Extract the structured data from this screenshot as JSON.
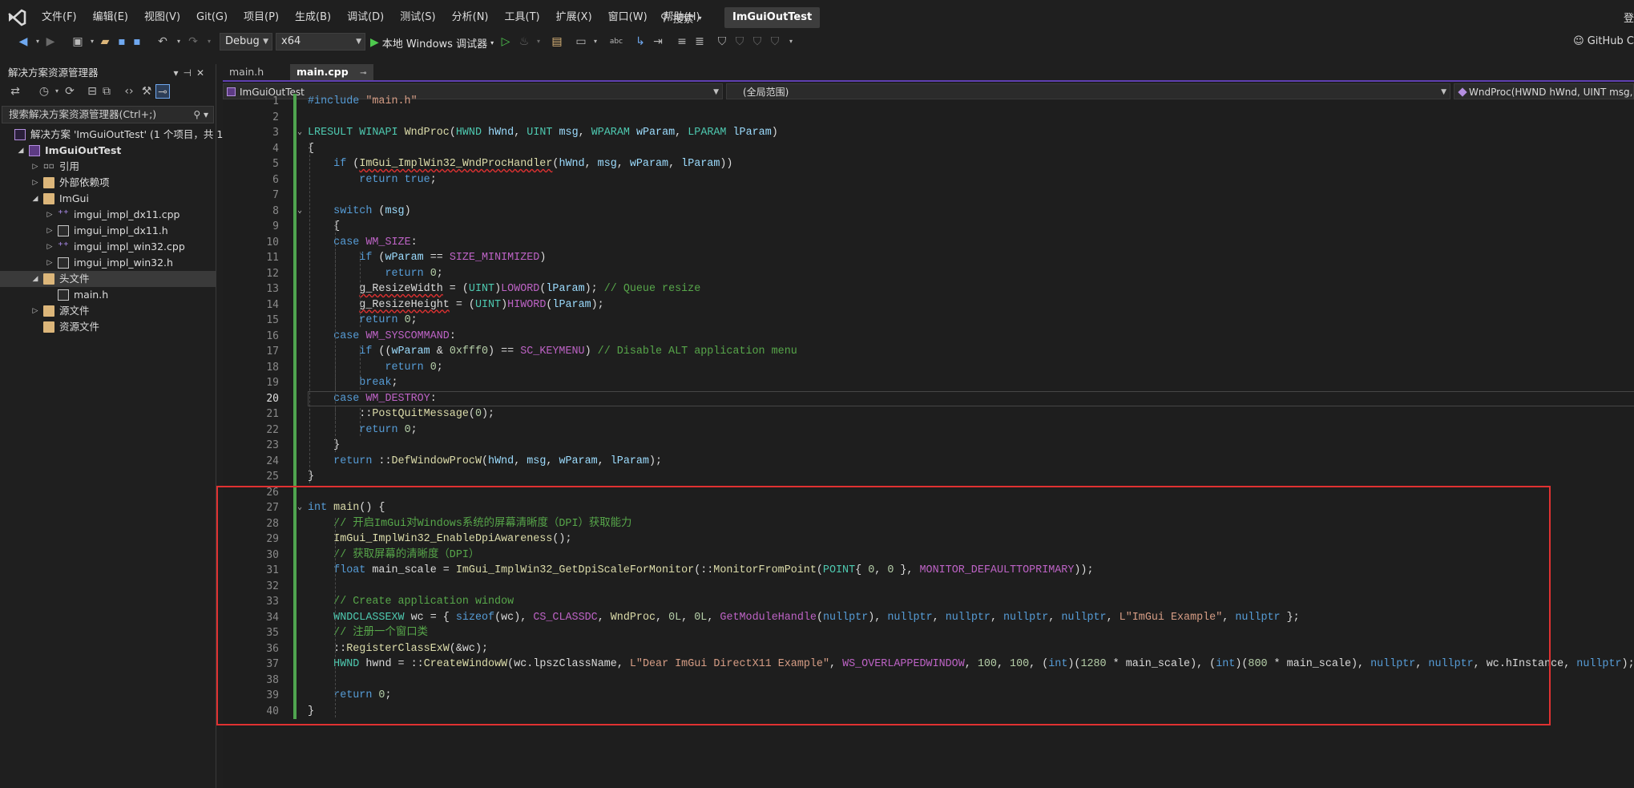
{
  "menubar": {
    "items": [
      "文件(F)",
      "编辑(E)",
      "视图(V)",
      "Git(G)",
      "项目(P)",
      "生成(B)",
      "调试(D)",
      "测试(S)",
      "分析(N)",
      "工具(T)",
      "扩展(X)",
      "窗口(W)",
      "帮助(H)"
    ],
    "search_label": "搜索",
    "solution_title": "ImGuiOutTest",
    "signin_label": "登"
  },
  "toolbar": {
    "configuration": "Debug",
    "platform": "x64",
    "run_label": "本地 Windows 调试器",
    "copilot_label": "GitHub C"
  },
  "solution_explorer": {
    "title": "解决方案资源管理器",
    "search_placeholder": "搜索解决方案资源管理器(Ctrl+;)",
    "tree": [
      {
        "label": "解决方案 'ImGuiOutTest' (1 个项目，共 1",
        "level": 0,
        "icon": "solution-icon",
        "expander": ""
      },
      {
        "label": "ImGuiOutTest",
        "level": 1,
        "icon": "project-icon",
        "expander": "open",
        "bold": true
      },
      {
        "label": "引用",
        "level": 2,
        "icon": "references-icon",
        "expander": "closed"
      },
      {
        "label": "外部依赖项",
        "level": 2,
        "icon": "external-deps-icon",
        "expander": "closed"
      },
      {
        "label": "ImGui",
        "level": 2,
        "icon": "folder-icon",
        "expander": "open"
      },
      {
        "label": "imgui_impl_dx11.cpp",
        "level": 3,
        "icon": "cpp-file-icon",
        "expander": "closed"
      },
      {
        "label": "imgui_impl_dx11.h",
        "level": 3,
        "icon": "header-file-icon",
        "expander": "closed"
      },
      {
        "label": "imgui_impl_win32.cpp",
        "level": 3,
        "icon": "cpp-file-icon",
        "expander": "closed"
      },
      {
        "label": "imgui_impl_win32.h",
        "level": 3,
        "icon": "header-file-icon",
        "expander": "closed"
      },
      {
        "label": "头文件",
        "level": 2,
        "icon": "folder-icon",
        "expander": "open",
        "selected": true
      },
      {
        "label": "main.h",
        "level": 3,
        "icon": "header-file-icon",
        "expander": ""
      },
      {
        "label": "源文件",
        "level": 2,
        "icon": "folder-icon",
        "expander": "closed"
      },
      {
        "label": "资源文件",
        "level": 2,
        "icon": "folder-icon",
        "expander": ""
      }
    ]
  },
  "tabs": [
    {
      "label": "main.h",
      "active": false
    },
    {
      "label": "main.cpp",
      "active": true
    }
  ],
  "navbar": {
    "project": "ImGuiOutTest",
    "scope": "(全局范围)",
    "member": "WndProc(HWND hWnd, UINT msg, WPARAM wParam, LPARAM lParam)"
  },
  "editor": {
    "current_line": 20,
    "lines": [
      "#include \"main.h\"",
      "",
      "LRESULT WINAPI WndProc(HWND hWnd, UINT msg, WPARAM wParam, LPARAM lParam)",
      "{",
      "    if (ImGui_ImplWin32_WndProcHandler(hWnd, msg, wParam, lParam))",
      "        return true;",
      "",
      "    switch (msg)",
      "    {",
      "    case WM_SIZE:",
      "        if (wParam == SIZE_MINIMIZED)",
      "            return 0;",
      "        g_ResizeWidth = (UINT)LOWORD(lParam); // Queue resize",
      "        g_ResizeHeight = (UINT)HIWORD(lParam);",
      "        return 0;",
      "    case WM_SYSCOMMAND:",
      "        if ((wParam & 0xfff0) == SC_KEYMENU) // Disable ALT application menu",
      "            return 0;",
      "        break;",
      "    case WM_DESTROY:",
      "        ::PostQuitMessage(0);",
      "        return 0;",
      "    }",
      "    return ::DefWindowProcW(hWnd, msg, wParam, lParam);",
      "}",
      "",
      "int main() {",
      "    // 开启ImGui对Windows系统的屏幕清晰度（DPI）获取能力",
      "    ImGui_ImplWin32_EnableDpiAwareness();",
      "    // 获取屏幕的清晰度（DPI）",
      "    float main_scale = ImGui_ImplWin32_GetDpiScaleForMonitor(::MonitorFromPoint(POINT{ 0, 0 }, MONITOR_DEFAULTTOPRIMARY));",
      "",
      "    // Create application window",
      "    WNDCLASSEXW wc = { sizeof(wc), CS_CLASSDC, WndProc, 0L, 0L, GetModuleHandle(nullptr), nullptr, nullptr, nullptr, nullptr, L\"ImGui Example\", nullptr };",
      "    // 注册一个窗口类",
      "    ::RegisterClassExW(&wc);",
      "    HWND hwnd = ::CreateWindowW(wc.lpszClassName, L\"Dear ImGui DirectX11 Example\", WS_OVERLAPPEDWINDOW, 100, 100, (int)(1280 * main_scale), (int)(800 * main_scale), nullptr, nullptr, wc.hInstance, nullptr);",
      "",
      "    return 0;",
      "}"
    ]
  },
  "colors": {
    "accent": "#5e3fb0",
    "highlight_box": "#e03131",
    "change_bar": "#4fa44f"
  }
}
